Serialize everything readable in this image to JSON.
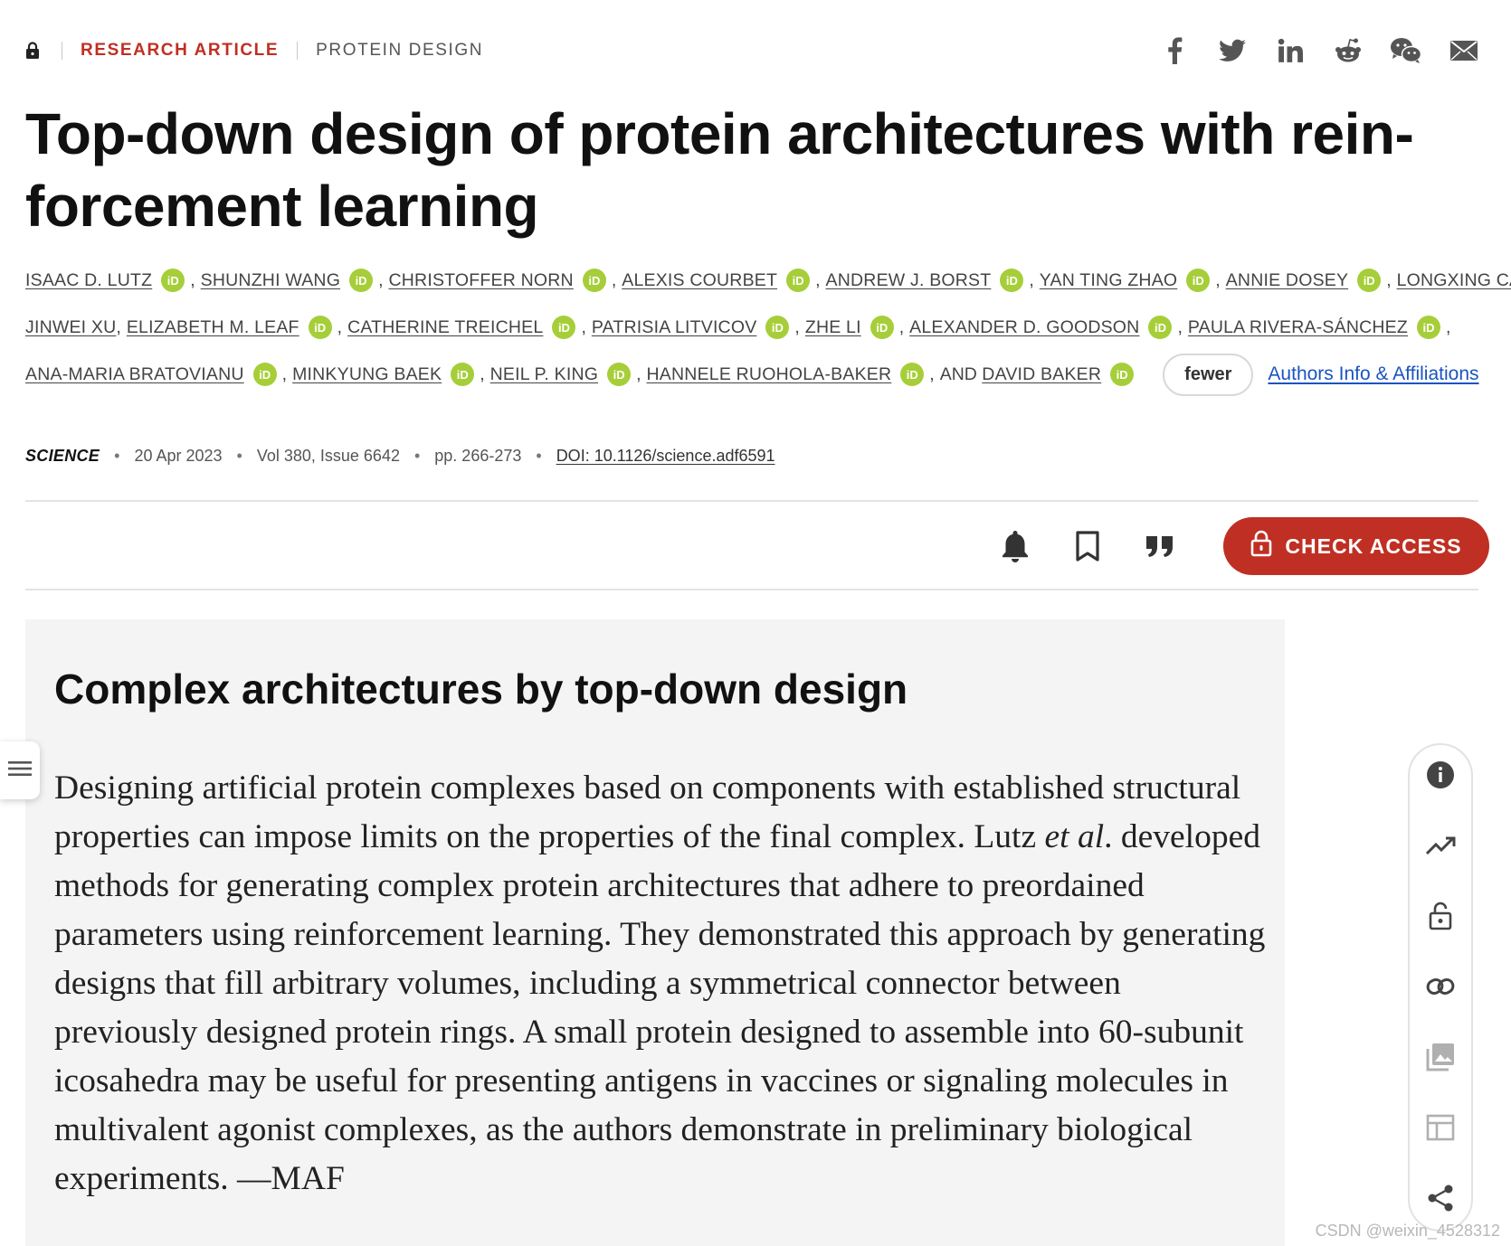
{
  "topbar": {
    "access_type_label": "RESEARCH ARTICLE",
    "subject_label": "PROTEIN DESIGN",
    "share_icons": [
      "facebook-icon",
      "twitter-icon",
      "linkedin-icon",
      "reddit-icon",
      "wechat-icon",
      "email-icon"
    ]
  },
  "article": {
    "title": "Top-down design of protein architectures with rein-forcement learning",
    "title_line1": "Top-down design of protein architectures with rein-",
    "title_line2": "forcement learning"
  },
  "authors": {
    "lines": [
      [
        {
          "name": "ISAAC D. LUTZ",
          "orcid": true
        },
        {
          "name": "SHUNZHI WANG",
          "orcid": true
        },
        {
          "name": "CHRISTOFFER NORN",
          "orcid": true
        },
        {
          "name": "ALEXIS COURBET",
          "orcid": true
        },
        {
          "name": "ANDREW J. BORST",
          "orcid": true
        },
        {
          "name": "YAN TING ZHAO",
          "orcid": true
        },
        {
          "name": "ANNIE DOSEY",
          "orcid": true
        },
        {
          "name": "LONGXING CAO",
          "orcid": false
        }
      ],
      [
        {
          "name": "JINWEI XU",
          "orcid": false
        },
        {
          "name": "ELIZABETH M. LEAF",
          "orcid": true
        },
        {
          "name": "CATHERINE TREICHEL",
          "orcid": true
        },
        {
          "name": "PATRISIA LITVICOV",
          "orcid": true
        },
        {
          "name": "ZHE LI",
          "orcid": true
        },
        {
          "name": "ALEXANDER D. GOODSON",
          "orcid": true
        },
        {
          "name": "PAULA RIVERA-SÁNCHEZ",
          "orcid": true
        }
      ],
      [
        {
          "name": "ANA-MARIA BRATOVIANU",
          "orcid": true
        },
        {
          "name": "MINKYUNG BAEK",
          "orcid": true
        },
        {
          "name": "NEIL P. KING",
          "orcid": true
        },
        {
          "name": "HANNELE RUOHOLA-BAKER",
          "orcid": true
        },
        {
          "name": "DAVID BAKER",
          "orcid": true,
          "prefix": "AND "
        }
      ]
    ],
    "orcid_label": "iD",
    "fewer_label": "fewer",
    "affiliations_label": "Authors Info & Affiliations"
  },
  "meta": {
    "journal": "SCIENCE",
    "date": "20 Apr 2023",
    "volume_issue": "Vol 380, Issue 6642",
    "pages": "pp. 266-273",
    "doi": "DOI: 10.1126/science.adf6591"
  },
  "toolbar": {
    "check_access_label": "CHECK ACCESS",
    "icons": [
      "bell-icon",
      "bookmark-icon",
      "quote-icon"
    ]
  },
  "summary": {
    "heading": "Complex architectures by top-down design",
    "text_before_em": "Designing artificial protein complexes based on components with established structural properties can impose limits on the properties of the final complex. Lutz ",
    "text_em": "et al",
    "text_after_em": ". developed methods for generating complex protein architectures that adhere to preordained parameters using reinforcement learning. They demonstrated this approach by generating designs that fill arbitrary volumes, including a symmetri­cal connector between previously designed protein rings. A small protein designed to assemble into 60-subunit icosahedra may be useful for presenting antigens in vaccines or signaling molecules in multivalent agonist complexes, as the authors demonstrate in preliminary biological experiments. —MAF"
  },
  "sidebar": {
    "icons": [
      "info-icon",
      "trending-icon",
      "unlock-icon",
      "link-icon",
      "images-icon",
      "table-icon",
      "share-icon"
    ]
  },
  "watermark": "CSDN @weixin_4528312",
  "colors": {
    "accent_red": "#c02f23",
    "orcid_green": "#a6ce39",
    "link_blue": "#1a54c0",
    "summary_bg": "#f4f4f4"
  }
}
